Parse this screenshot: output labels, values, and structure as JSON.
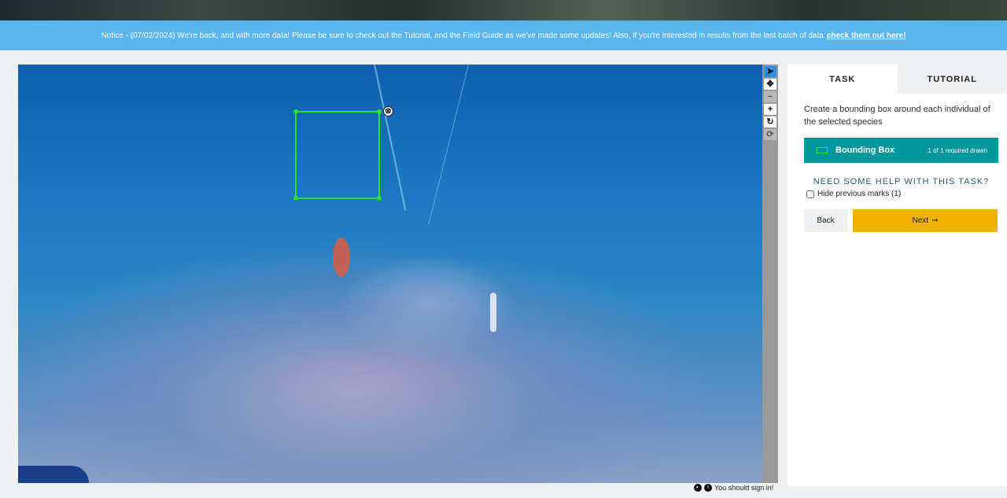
{
  "notice": {
    "text": "Notice - (07/02/2024) We're back, and with more data! Please be sure to check out the Tutorial, and the Field Guide as we've made some updates! Also, if you're interested in results from the last batch of data",
    "link_label": "check them out here!"
  },
  "subject": {
    "annotation": {
      "delete_glyph": "⊗"
    }
  },
  "toolbar": {
    "tools": [
      {
        "name": "pointer-tool",
        "glyph": "➤"
      },
      {
        "name": "move-tool",
        "glyph": "✥"
      },
      {
        "name": "zoom-out-tool",
        "glyph": "−"
      },
      {
        "name": "zoom-in-tool",
        "glyph": "+"
      },
      {
        "name": "rotate-tool",
        "glyph": "↻"
      },
      {
        "name": "reset-tool",
        "glyph": "⟳"
      }
    ]
  },
  "footer": {
    "sign_in_note": "You should sign in!"
  },
  "panel": {
    "tabs": {
      "task": "TASK",
      "tutorial": "TUTORIAL"
    },
    "instructions": "Create a bounding box around each individual of the selected species",
    "tool_option": {
      "label": "Bounding Box",
      "count": "1 of 1 required drawn",
      "color": "#2de02d"
    },
    "help_label": "NEED SOME HELP WITH THIS TASK?",
    "hide_marks_label": "Hide previous marks (1)",
    "back_label": "Back",
    "next_label": "Next",
    "next_arrow": "➞"
  },
  "colors": {
    "notice_bg": "#5ab4ee",
    "tool_active": "#00979d",
    "next_button": "#f0b100"
  }
}
